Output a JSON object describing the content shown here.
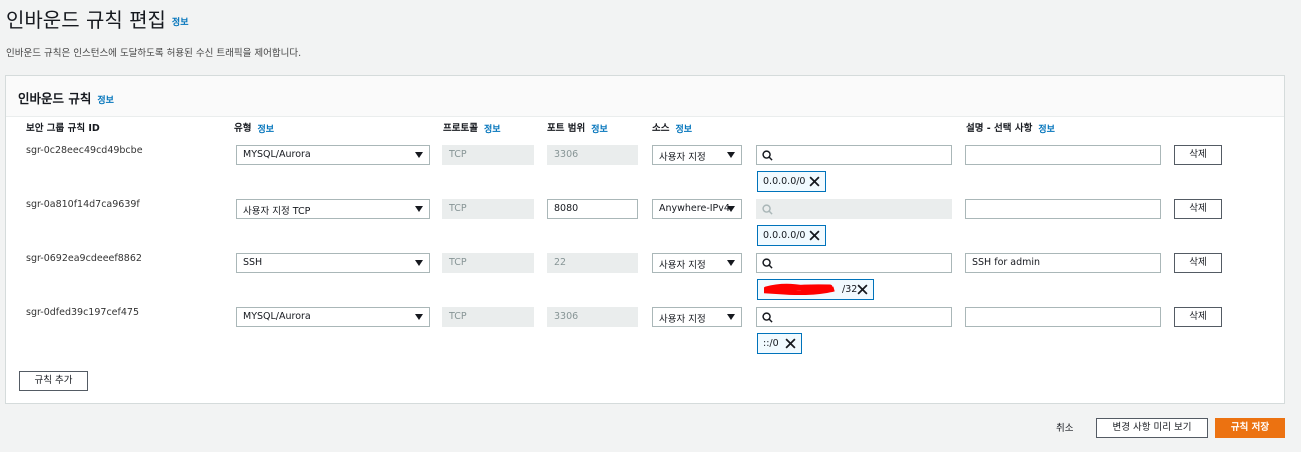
{
  "page": {
    "title": "인바운드 규칙 편집",
    "title_info": "정보",
    "description": "인바운드 규칙은 인스턴스에 도달하도록 허용된 수신 트래픽을 제어합니다."
  },
  "panel": {
    "title": "인바운드 규칙",
    "title_info": "정보",
    "columns": {
      "rule_id": "보안 그룹 규칙 ID",
      "type": "유형",
      "type_info": "정보",
      "protocol": "프로토콜",
      "protocol_info": "정보",
      "port_range": "포트 범위",
      "port_range_info": "정보",
      "source": "소스",
      "source_info": "정보",
      "description": "설명 - 선택 사항",
      "description_info": "정보"
    },
    "rows": [
      {
        "id": "sgr-0c28eec49cd49bcbe",
        "type": "MYSQL/Aurora",
        "protocol": "TCP",
        "port": "3306",
        "source": "사용자 지정",
        "search": "",
        "token": "0.0.0.0/0",
        "description": "",
        "delete": "삭제"
      },
      {
        "id": "sgr-0a810f14d7ca9639f",
        "type": "사용자 지정 TCP",
        "protocol": "TCP",
        "port": "8080",
        "source": "Anywhere-IPv4",
        "search": "",
        "token": "0.0.0.0/0",
        "description": "",
        "delete": "삭제"
      },
      {
        "id": "sgr-0692ea9cdeeef8862",
        "type": "SSH",
        "protocol": "TCP",
        "port": "22",
        "source": "사용자 지정",
        "search": "",
        "token": "/32",
        "description": "SSH for admin",
        "delete": "삭제"
      },
      {
        "id": "sgr-0dfed39c197cef475",
        "type": "MYSQL/Aurora",
        "protocol": "TCP",
        "port": "3306",
        "source": "사용자 지정",
        "search": "",
        "token": "::/0",
        "description": "",
        "delete": "삭제"
      }
    ],
    "add_rule": "규칙 추가"
  },
  "footer": {
    "cancel": "취소",
    "preview": "변경 사항 미리 보기",
    "save": "규칙 저장"
  },
  "colors": {
    "link": "#0073bb",
    "primary": "#ec7211",
    "token_border": "#0073bb",
    "redaction": "#ff0000"
  }
}
